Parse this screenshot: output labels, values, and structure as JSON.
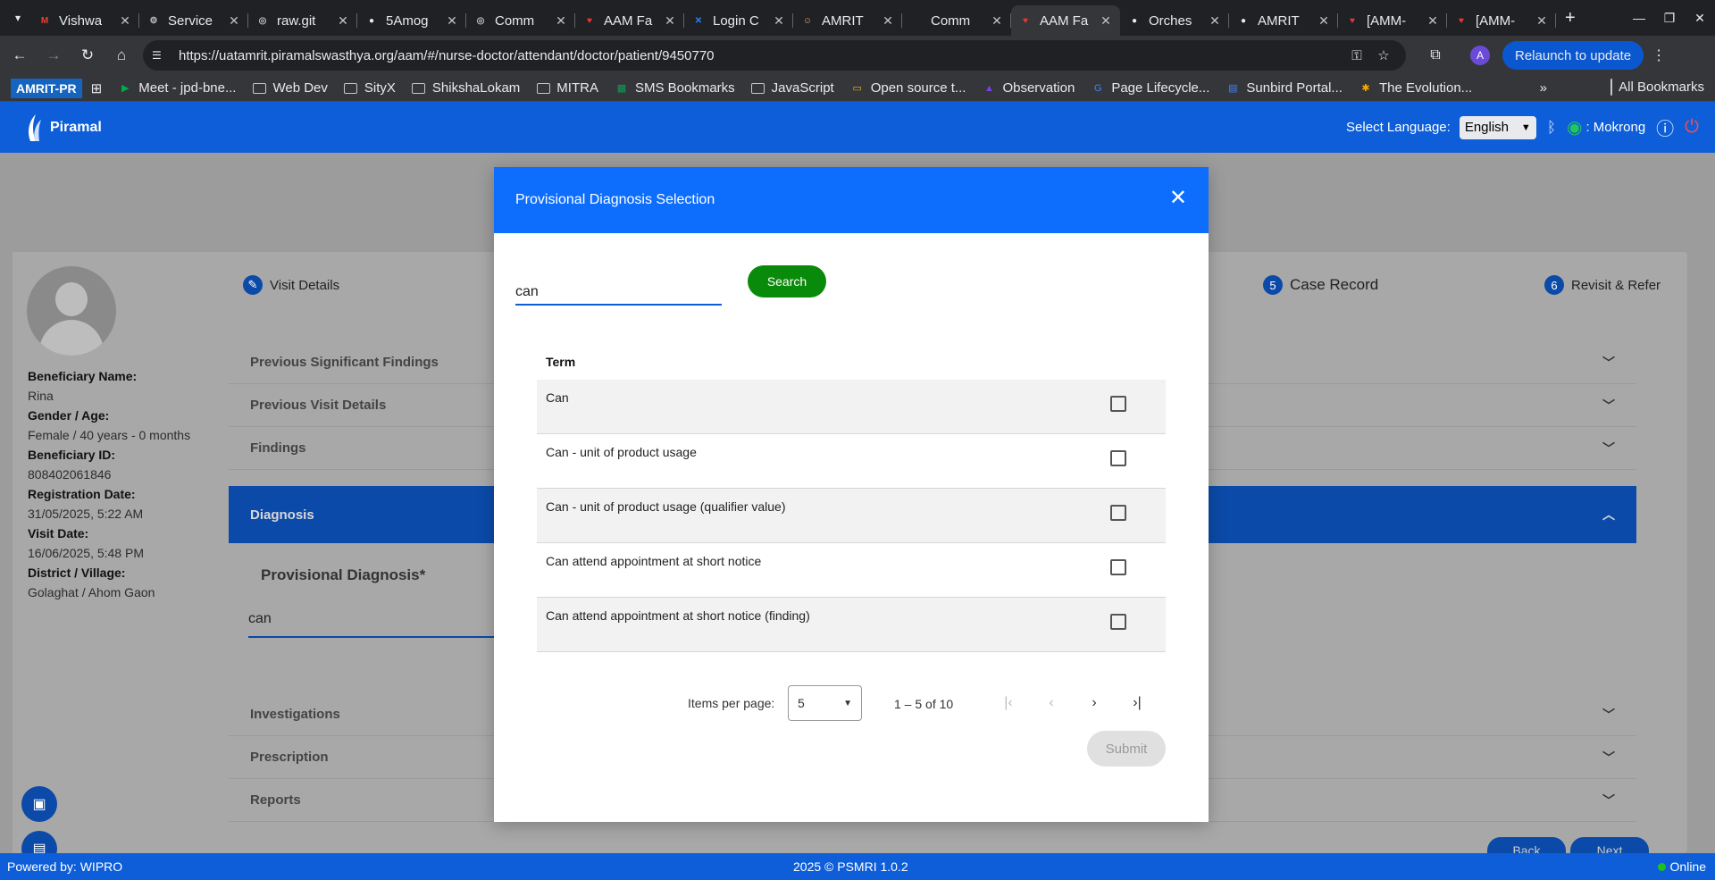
{
  "browser": {
    "tabs": [
      {
        "title": "Vishwa",
        "icon": "gmail-icon",
        "color": "#ea4335",
        "glyph": "M"
      },
      {
        "title": "Service",
        "icon": "settings-icon",
        "color": "#bdc1c6",
        "glyph": "⚙"
      },
      {
        "title": "raw.git",
        "icon": "globe-icon",
        "color": "#bdc1c6",
        "glyph": "◎"
      },
      {
        "title": "5Amog",
        "icon": "github-icon",
        "color": "#e8eaed",
        "glyph": "●"
      },
      {
        "title": "Comm",
        "icon": "globe-icon",
        "color": "#bdc1c6",
        "glyph": "◎"
      },
      {
        "title": "AAM Fa",
        "icon": "amrit-icon",
        "color": "#e53935",
        "glyph": "♥"
      },
      {
        "title": "Login C",
        "icon": "confluence-icon",
        "color": "#2684ff",
        "glyph": "✕"
      },
      {
        "title": "AMRIT",
        "icon": "avatar-icon",
        "color": "#d7a86e",
        "glyph": "☺"
      },
      {
        "title": "Comm",
        "icon": "github-icon",
        "color": "#202124",
        "glyph": "●"
      },
      {
        "title": "AAM Fa",
        "icon": "amrit-icon",
        "color": "#e53935",
        "glyph": "♥"
      },
      {
        "title": "Orches",
        "icon": "github-icon",
        "color": "#e8eaed",
        "glyph": "●"
      },
      {
        "title": "AMRIT",
        "icon": "github-icon",
        "color": "#e8eaed",
        "glyph": "●"
      },
      {
        "title": "[AMM-",
        "icon": "amrit-icon",
        "color": "#e53935",
        "glyph": "♥"
      },
      {
        "title": "[AMM-",
        "icon": "amrit-icon",
        "color": "#e53935",
        "glyph": "♥"
      }
    ],
    "url": "https://uatamrit.piramalswasthya.org/aam/#/nurse-doctor/attendant/doctor/patient/9450770",
    "relaunch": "Relaunch to update",
    "profile_initial": "A",
    "bookmarks": [
      {
        "label": "Meet - jpd-bne...",
        "icon": "meet-icon"
      },
      {
        "label": "Web Dev",
        "icon": "folder-icon"
      },
      {
        "label": "SityX",
        "icon": "folder-icon"
      },
      {
        "label": "ShikshaLokam",
        "icon": "folder-icon"
      },
      {
        "label": "MITRA",
        "icon": "folder-icon"
      },
      {
        "label": "SMS Bookmarks",
        "icon": "sheets-icon"
      },
      {
        "label": "JavaScript",
        "icon": "folder-icon"
      },
      {
        "label": "Open source t...",
        "icon": "slides-icon"
      },
      {
        "label": "Observation",
        "icon": "triangle-icon"
      },
      {
        "label": "Page Lifecycle...",
        "icon": "google-icon"
      },
      {
        "label": "Sunbird Portal...",
        "icon": "docs-icon"
      },
      {
        "label": "The Evolution...",
        "icon": "asterisk-icon"
      }
    ],
    "bookmark_prefix": "AMRIT-PR",
    "all_bookmarks": "All Bookmarks"
  },
  "app": {
    "brand": "Piramal",
    "select_language_label": "Select Language:",
    "language": "English",
    "user": ": Mokrong",
    "footer_left": "Powered by: WIPRO",
    "footer_center": "2025 © PSMRI 1.0.2",
    "footer_status": "Online"
  },
  "patient": {
    "fields": [
      {
        "label": "Beneficiary Name:",
        "value": "Rina"
      },
      {
        "label": "Gender / Age:",
        "value": "Female / 40 years - 0 months"
      },
      {
        "label": "Beneficiary ID:",
        "value": "808402061846"
      },
      {
        "label": "Registration Date:",
        "value": "31/05/2025, 5:22 AM"
      },
      {
        "label": "Visit Date:",
        "value": "16/06/2025, 5:48 PM"
      },
      {
        "label": "District / Village:",
        "value": "Golaghat / Ahom Gaon"
      }
    ]
  },
  "stepper": {
    "visit": "Visit Details",
    "case_num": "5",
    "case": "Case Record",
    "revisit_num": "6",
    "revisit": "Revisit & Refer"
  },
  "sections": {
    "top": [
      "Previous Significant Findings",
      "Previous Visit Details",
      "Findings"
    ],
    "diagnosis": "Diagnosis",
    "provisional_label": "Provisional Diagnosis*",
    "provisional_value": "can",
    "bottom": [
      "Investigations",
      "Prescription",
      "Reports"
    ],
    "back": "Back",
    "next": "Next"
  },
  "modal": {
    "title": "Provisional Diagnosis Selection",
    "search_value": "can",
    "search_button": "Search",
    "column_header": "Term",
    "rows": [
      {
        "term": "Can"
      },
      {
        "term": "Can - unit of product usage"
      },
      {
        "term": "Can - unit of product usage (qualifier value)"
      },
      {
        "term": "Can attend appointment at short notice"
      },
      {
        "term": "Can attend appointment at short notice (finding)"
      }
    ],
    "items_per_page_label": "Items per page:",
    "items_per_page": "5",
    "range": "1 – 5 of 10",
    "submit": "Submit"
  },
  "colors": {
    "app_blue": "#0d5ed8",
    "modal_header": "#0d6efd",
    "search_button": "#0a8a0a"
  }
}
